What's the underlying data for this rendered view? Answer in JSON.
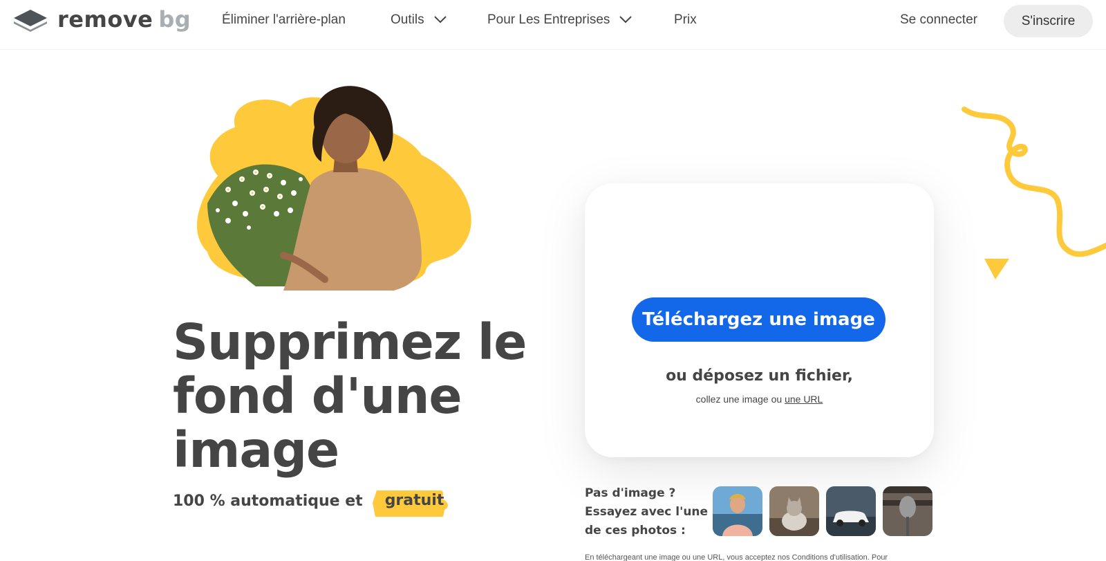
{
  "header": {
    "logo": {
      "word1": "remove",
      "word2": "bg",
      "icon": "layers-logo-icon"
    },
    "nav": [
      {
        "label": "Éliminer l'arrière-plan",
        "has_dropdown": false
      },
      {
        "label": "Outils",
        "has_dropdown": true
      },
      {
        "label": "Pour Les Entreprises",
        "has_dropdown": true
      },
      {
        "label": "Prix",
        "has_dropdown": false
      }
    ],
    "login_label": "Se connecter",
    "signup_label": "S'inscrire"
  },
  "hero": {
    "headline": "Supprimez le fond d'une image",
    "subline_prefix": "100 % automatique et",
    "subline_highlight": "gratuit"
  },
  "upload": {
    "button_label": "Téléchargez une image",
    "drop_text": "ou déposez un fichier,",
    "paste_prefix": "collez une image ou",
    "url_link": "une URL"
  },
  "samples": {
    "prompt": "Pas d'image ? Essayez avec l'une de ces photos :",
    "thumbnails": [
      "person-photo",
      "cat-photo",
      "car-photo",
      "microphone-photo"
    ]
  },
  "terms_text": "En téléchargeant une image ou une URL, vous acceptez nos Conditions d'utilisation. Pour",
  "colors": {
    "accent_blue": "#1268e8",
    "accent_yellow": "#ffc93c",
    "text_dark": "#454545",
    "logo_grey": "#a9aeb3"
  }
}
